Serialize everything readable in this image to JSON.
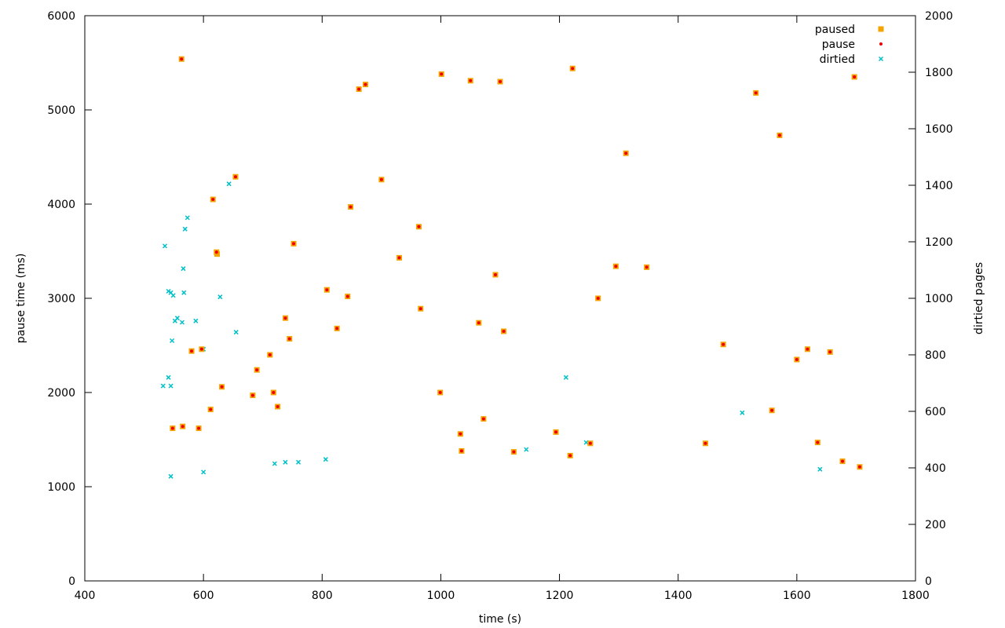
{
  "chart_data": {
    "type": "scatter",
    "title": "",
    "xlabel": "time (s)",
    "ylabel": "pause time (ms)",
    "y2label": "dirtied pages",
    "xlim": [
      400,
      1800
    ],
    "ylim": [
      0,
      6000
    ],
    "y2lim": [
      0,
      2000
    ],
    "xticks": [
      "400",
      "600",
      "800",
      "1000",
      "1200",
      "1400",
      "1600",
      "1800"
    ],
    "yticks": [
      "0",
      "1000",
      "2000",
      "3000",
      "4000",
      "5000",
      "6000"
    ],
    "y2ticks": [
      "0",
      "200",
      "400",
      "600",
      "800",
      "1000",
      "1200",
      "1400",
      "1600",
      "1800",
      "2000"
    ],
    "grid": false,
    "legend_position": "top-right",
    "colors": {
      "paused": "#f4a300",
      "pause": "#ee0000",
      "dirtied": "#00c0c8"
    },
    "series": [
      {
        "name": "paused",
        "axis": "y",
        "marker": "square",
        "points": [
          [
            563,
            5540
          ],
          [
            616,
            4050
          ],
          [
            622,
            3490
          ],
          [
            623,
            3470
          ],
          [
            654,
            4290
          ],
          [
            752,
            3580
          ],
          [
            808,
            3090
          ],
          [
            843,
            3020
          ],
          [
            848,
            3970
          ],
          [
            862,
            5220
          ],
          [
            873,
            5270
          ],
          [
            900,
            4260
          ],
          [
            930,
            3430
          ],
          [
            963,
            3760
          ],
          [
            966,
            2890
          ],
          [
            1001,
            5380
          ],
          [
            1050,
            5310
          ],
          [
            1064,
            2740
          ],
          [
            1092,
            3250
          ],
          [
            1100,
            5300
          ],
          [
            1106,
            2650
          ],
          [
            1222,
            5440
          ],
          [
            1265,
            3000
          ],
          [
            1295,
            3340
          ],
          [
            1312,
            4540
          ],
          [
            1347,
            3330
          ],
          [
            1476,
            2510
          ],
          [
            1531,
            5180
          ],
          [
            1571,
            4730
          ],
          [
            1600,
            2350
          ],
          [
            1618,
            2460
          ],
          [
            1656,
            2430
          ],
          [
            1697,
            5350
          ],
          [
            745,
            2570
          ],
          [
            738,
            2790
          ],
          [
            825,
            2680
          ],
          [
            580,
            2440
          ],
          [
            597,
            2460
          ],
          [
            612,
            1820
          ],
          [
            631,
            2060
          ],
          [
            548,
            1620
          ],
          [
            565,
            1640
          ],
          [
            592,
            1620
          ],
          [
            690,
            2240
          ],
          [
            718,
            2000
          ],
          [
            712,
            2400
          ],
          [
            725,
            1850
          ],
          [
            683,
            1970
          ],
          [
            999,
            2000
          ],
          [
            1033,
            1560
          ],
          [
            1072,
            1720
          ],
          [
            1194,
            1580
          ],
          [
            1252,
            1460
          ],
          [
            1558,
            1810
          ],
          [
            1635,
            1470
          ],
          [
            1446,
            1460
          ],
          [
            1035,
            1380
          ],
          [
            1123,
            1370
          ],
          [
            1218,
            1330
          ],
          [
            1677,
            1270
          ],
          [
            1706,
            1210
          ]
        ]
      },
      {
        "name": "pause",
        "axis": "y",
        "marker": "dot",
        "points": [
          [
            563,
            5540
          ],
          [
            616,
            4050
          ],
          [
            622,
            3490
          ],
          [
            654,
            4290
          ],
          [
            752,
            3580
          ],
          [
            808,
            3090
          ],
          [
            843,
            3020
          ],
          [
            848,
            3970
          ],
          [
            862,
            5220
          ],
          [
            873,
            5270
          ],
          [
            900,
            4260
          ],
          [
            930,
            3430
          ],
          [
            963,
            3760
          ],
          [
            966,
            2890
          ],
          [
            1001,
            5380
          ],
          [
            1050,
            5310
          ],
          [
            1064,
            2740
          ],
          [
            1092,
            3250
          ],
          [
            1100,
            5300
          ],
          [
            1106,
            2650
          ],
          [
            1222,
            5440
          ],
          [
            1265,
            3000
          ],
          [
            1295,
            3340
          ],
          [
            1312,
            4540
          ],
          [
            1347,
            3330
          ],
          [
            1476,
            2510
          ],
          [
            1531,
            5180
          ],
          [
            1571,
            4730
          ],
          [
            1600,
            2350
          ],
          [
            1618,
            2460
          ],
          [
            1656,
            2430
          ],
          [
            1697,
            5350
          ],
          [
            745,
            2570
          ],
          [
            738,
            2790
          ],
          [
            825,
            2680
          ],
          [
            580,
            2440
          ],
          [
            597,
            2460
          ],
          [
            612,
            1820
          ],
          [
            631,
            2060
          ],
          [
            548,
            1620
          ],
          [
            565,
            1640
          ],
          [
            592,
            1620
          ],
          [
            690,
            2240
          ],
          [
            718,
            2000
          ],
          [
            712,
            2400
          ],
          [
            725,
            1850
          ],
          [
            683,
            1970
          ],
          [
            999,
            2000
          ],
          [
            1033,
            1560
          ],
          [
            1072,
            1720
          ],
          [
            1194,
            1580
          ],
          [
            1252,
            1460
          ],
          [
            1558,
            1810
          ],
          [
            1635,
            1470
          ],
          [
            1446,
            1460
          ],
          [
            1035,
            1380
          ],
          [
            1123,
            1370
          ],
          [
            1218,
            1330
          ],
          [
            1677,
            1270
          ],
          [
            1706,
            1210
          ]
        ]
      },
      {
        "name": "dirtied",
        "axis": "y2",
        "marker": "x",
        "points": [
          [
            563,
            1845
          ],
          [
            535,
            1185
          ],
          [
            541,
            1025
          ],
          [
            545,
            1020
          ],
          [
            549,
            1010
          ],
          [
            573,
            1285
          ],
          [
            569,
            1245
          ],
          [
            566,
            1105
          ],
          [
            567,
            1020
          ],
          [
            587,
            920
          ],
          [
            600,
            820
          ],
          [
            628,
            1005
          ],
          [
            643,
            1405
          ],
          [
            655,
            880
          ],
          [
            541,
            720
          ],
          [
            545,
            690
          ],
          [
            532,
            690
          ],
          [
            552,
            920
          ],
          [
            556,
            930
          ],
          [
            547,
            850
          ],
          [
            564,
            915
          ],
          [
            1211,
            720
          ],
          [
            1508,
            595
          ],
          [
            760,
            420
          ],
          [
            806,
            430
          ],
          [
            720,
            415
          ],
          [
            738,
            420
          ],
          [
            545,
            370
          ],
          [
            600,
            385
          ],
          [
            1144,
            465
          ],
          [
            1245,
            490
          ],
          [
            1639,
            395
          ]
        ]
      }
    ]
  }
}
